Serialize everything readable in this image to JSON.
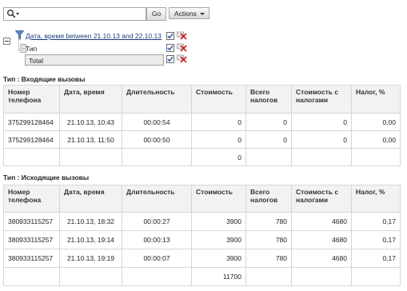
{
  "toolbar": {
    "search_value": "",
    "go_label": "Go",
    "actions_label": "Actions"
  },
  "filters": {
    "date_filter": "Дата, время between 21.10.13 and 22.10.13",
    "group_label": "Тип",
    "total_label": "Total"
  },
  "columns": [
    "Номер телефона",
    "Дата, время",
    "Длительность",
    "Стоимость",
    "Всего налогов",
    "Стоимость с налогами",
    "Налог, %"
  ],
  "sections": [
    {
      "title": "Тип : Входящие вызовы",
      "rows": [
        [
          "375299128464",
          "21.10.13, 10:43",
          "00:00:54",
          "0",
          "0",
          "0",
          "0,00"
        ],
        [
          "375299128464",
          "21.10.13, 11:50",
          "00:00:50",
          "0",
          "0",
          "0",
          "0,00"
        ]
      ],
      "total": "0"
    },
    {
      "title": "Тип : Исходящие вызовы",
      "rows": [
        [
          "380933115257",
          "21.10.13, 18:32",
          "00:00:27",
          "3900",
          "780",
          "4680",
          "0,17"
        ],
        [
          "380933115257",
          "21.10.13, 19:14",
          "00:00:13",
          "3900",
          "780",
          "4680",
          "0,17"
        ],
        [
          "380933115257",
          "21.10.13, 19:19",
          "00:00:07",
          "3900",
          "780",
          "4680",
          "0,17"
        ]
      ],
      "total": "11700"
    }
  ],
  "colors": {
    "link": "#1a3c7a",
    "header_bg": "#f2f2f2",
    "border": "#d6d6d6",
    "delete_red": "#cc2222"
  }
}
